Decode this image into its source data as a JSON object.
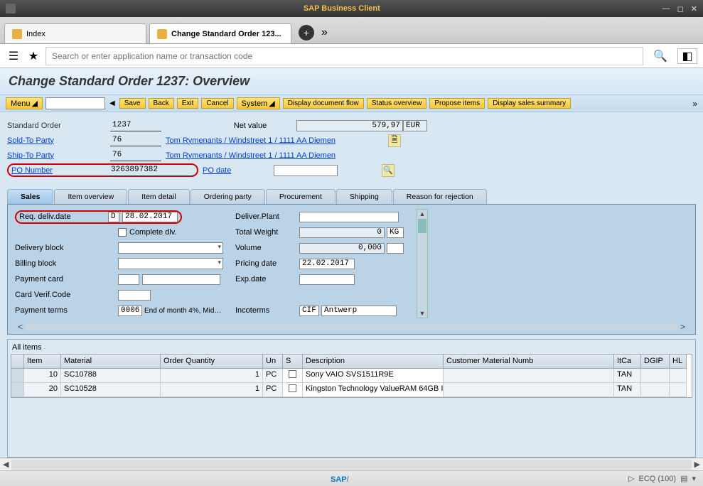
{
  "app_title": "SAP Business Client",
  "apptabs": {
    "t0": {
      "label": "Index"
    },
    "t1": {
      "label": "Change Standard Order 123..."
    }
  },
  "search": {
    "placeholder": "Search or enter application name or transaction code"
  },
  "page_title": "Change Standard Order 1237: Overview",
  "toolbar": {
    "menu": "Menu",
    "save": "Save",
    "back": "Back",
    "exit": "Exit",
    "cancel": "Cancel",
    "system": "System",
    "docflow": "Display document flow",
    "status": "Status overview",
    "propose": "Propose items",
    "summary": "Display sales summary"
  },
  "header": {
    "std_order_label": "Standard Order",
    "std_order": "1237",
    "netvalue_label": "Net value",
    "netvalue": "579,97",
    "currency": "EUR",
    "soldto_label": "Sold-To Party",
    "soldto": "76",
    "party_link": "Tom Rymenants / Windstreet 1 / 1111 AA Diemen",
    "shipto_label": "Ship-To Party",
    "shipto": "76",
    "pono_label": "PO Number",
    "pono": "3263897382",
    "podate_label": "PO date"
  },
  "tabs": {
    "sales": "Sales",
    "item_ov": "Item overview",
    "item_det": "Item detail",
    "ordering": "Ordering party",
    "proc": "Procurement",
    "ship": "Shipping",
    "reason": "Reason for rejection"
  },
  "panel": {
    "reqdeliv_label": "Req. deliv.date",
    "reqdeliv_type": "D",
    "reqdeliv_date": "28.02.2017",
    "complete_dlv": "Complete dlv.",
    "delivery_block_label": "Delivery block",
    "billing_block_label": "Billing block",
    "payment_card_label": "Payment card",
    "card_verif_label": "Card Verif.Code",
    "payment_terms_label": "Payment terms",
    "payment_terms_code": "0006",
    "payment_terms_text": "End of month 4%, Mid…",
    "deliver_plant_label": "Deliver.Plant",
    "total_weight_label": "Total Weight",
    "total_weight": "0",
    "weight_unit": "KG",
    "volume_label": "Volume",
    "volume": "0,000",
    "pricing_date_label": "Pricing date",
    "pricing_date": "22.02.2017",
    "exp_date_label": "Exp.date",
    "incoterms_label": "Incoterms",
    "incoterms_code": "CIF",
    "incoterms_loc": "Antwerp"
  },
  "grid": {
    "title": "All items",
    "cols": {
      "item": "Item",
      "material": "Material",
      "qty": "Order Quantity",
      "un": "Un",
      "s": "S",
      "desc": "Description",
      "custmat": "Customer Material Numb",
      "itca": "ItCa",
      "dgip": "DGIP",
      "hl": "HL"
    },
    "rows": [
      {
        "item": "10",
        "material": "SC10788",
        "qty": "1",
        "un": "PC",
        "desc": "Sony VAIO SVS1511R9E",
        "itca": "TAN"
      },
      {
        "item": "20",
        "material": "SC10528",
        "qty": "1",
        "un": "PC",
        "desc": "Kingston Technology ValueRAM 64GB I",
        "itca": "TAN"
      }
    ]
  },
  "footer": {
    "ecq": "ECQ (100)"
  }
}
